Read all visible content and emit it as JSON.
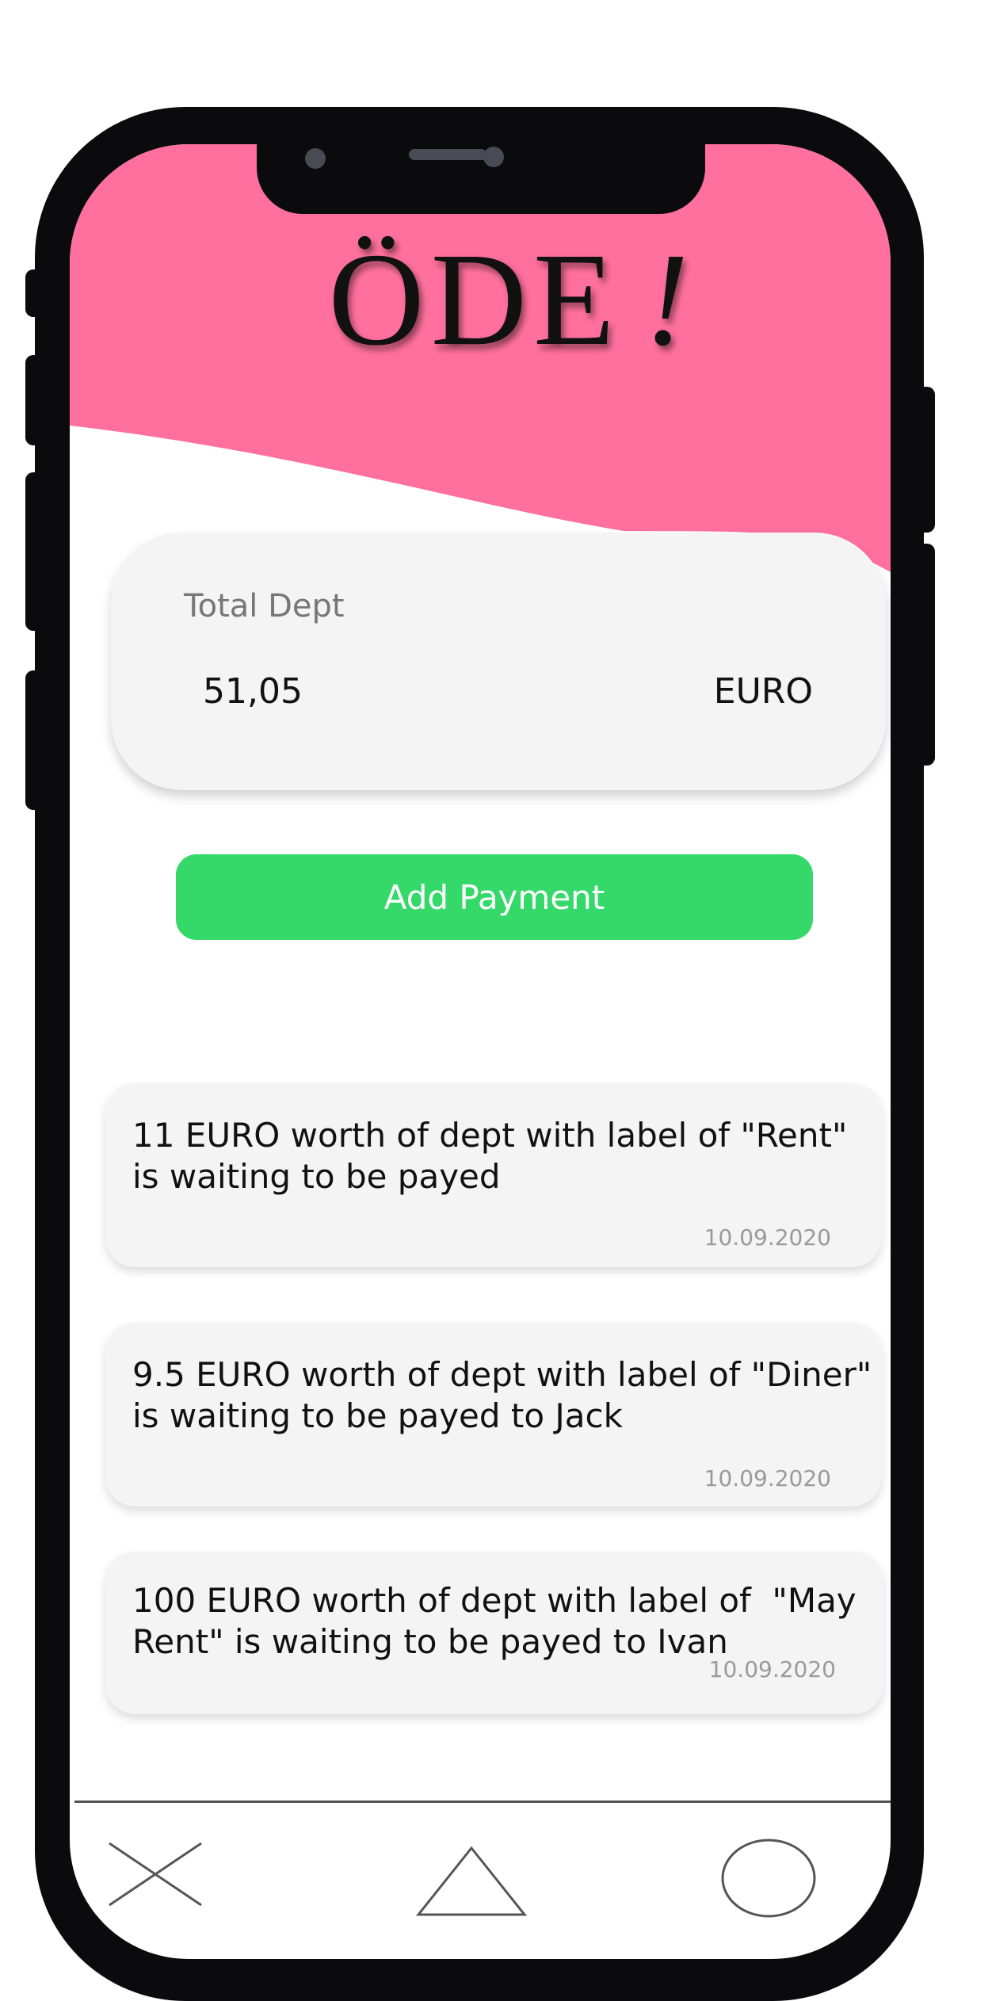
{
  "app": {
    "title": "ÖDE",
    "title_mark": "!"
  },
  "colors": {
    "header": "#ff709e",
    "accent_button": "#35d96a",
    "card": "#f4f4f4",
    "frame": "#0b0b0d"
  },
  "total": {
    "label": "Total Dept",
    "amount": "51,05",
    "currency": "EURO"
  },
  "actions": {
    "add_payment_label": "Add Payment"
  },
  "debts": [
    {
      "text": "11 EURO worth of dept with label of \"Rent\"\nis waiting to be payed",
      "date": "10.09.2020"
    },
    {
      "text": "9.5 EURO worth of dept with label of \"Diner\"\nis waiting to be payed to Jack",
      "date": "10.09.2020"
    },
    {
      "text": "100 EURO worth of dept with label of  \"May\nRent\" is waiting to be payed to Ivan",
      "date": "10.09.2020"
    }
  ],
  "tabbar": {
    "icons": [
      "close-icon",
      "triangle-icon",
      "circle-icon"
    ]
  }
}
